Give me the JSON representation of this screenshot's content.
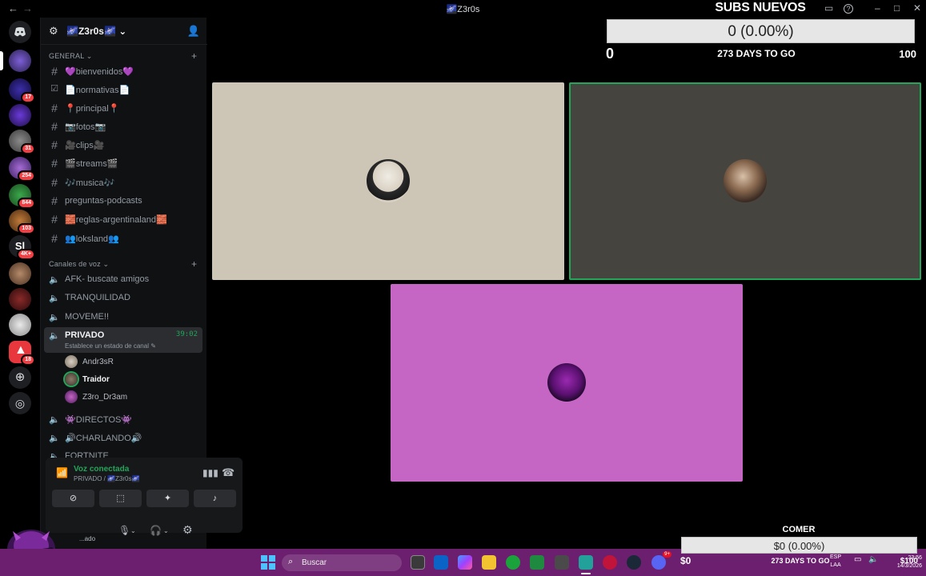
{
  "window": {
    "title": "Z3r0s",
    "title_emoji": "🌌"
  },
  "server": {
    "name": "Z3r0s",
    "name_suffix": "🌌"
  },
  "rail": {
    "badges": [
      "17",
      "31",
      "254",
      "844",
      "103",
      "4K+",
      "18"
    ]
  },
  "categories": {
    "general": "GENERAL",
    "voice": "Canales de voz"
  },
  "text_channels": [
    {
      "label": "💜bienvenidos💜"
    },
    {
      "label": "📄normativas📄"
    },
    {
      "label": "📍principal📍"
    },
    {
      "label": "📷fotos📷"
    },
    {
      "label": "🎥clips🎥"
    },
    {
      "label": "🎬streams🎬"
    },
    {
      "label": "🎶musica🎶"
    },
    {
      "label": "preguntas-podcasts"
    },
    {
      "label": "🧱reglas-argentinaland🧱"
    },
    {
      "label": "👥loksland👥"
    }
  ],
  "voice_channels": [
    {
      "label": "AFK- buscate amigos"
    },
    {
      "label": "TRANQUILIDAD"
    },
    {
      "label": "MOVEME!!"
    },
    {
      "label": "PRIVADO",
      "timer": "39:02",
      "status": "Establece un estado de canal"
    },
    {
      "label": "👾DIRECTOS👾"
    },
    {
      "label": "🔊CHARLANDO🔊"
    },
    {
      "label": "FORTNITE"
    }
  ],
  "voice_users": [
    {
      "name": "Andr3sR"
    },
    {
      "name": "Traidor"
    },
    {
      "name": "Z3ro_Dr3am"
    }
  ],
  "voice_panel": {
    "title": "Voz conectada",
    "subtitle": "PRIVADO / 🌌Z3r0s🌌"
  },
  "user_area": {
    "status": "...ado"
  },
  "subs_goal": {
    "title": "SUBS NUEVOS",
    "progress_text": "0 (0.00%)",
    "min": "0",
    "days": "273 DAYS TO GO",
    "max": "100",
    "progress": 0
  },
  "comer_goal": {
    "title": "COMER",
    "progress_text": "$0 (0.00%)",
    "min": "$0",
    "days": "273 DAYS TO GO",
    "max": "$100",
    "progress": 0
  },
  "taskbar": {
    "search_placeholder": "Buscar",
    "lang_1": "ESP",
    "lang_2": "LAA",
    "time": "23:56",
    "date": "14/3/2026",
    "discord_badge": "9+"
  },
  "colors": {
    "tile_1": "#cdc5b6",
    "tile_2": "#46443f",
    "tile_3": "#c565c4",
    "speaking_ring": "#23a55a",
    "taskbar": "#6b1f6e"
  }
}
